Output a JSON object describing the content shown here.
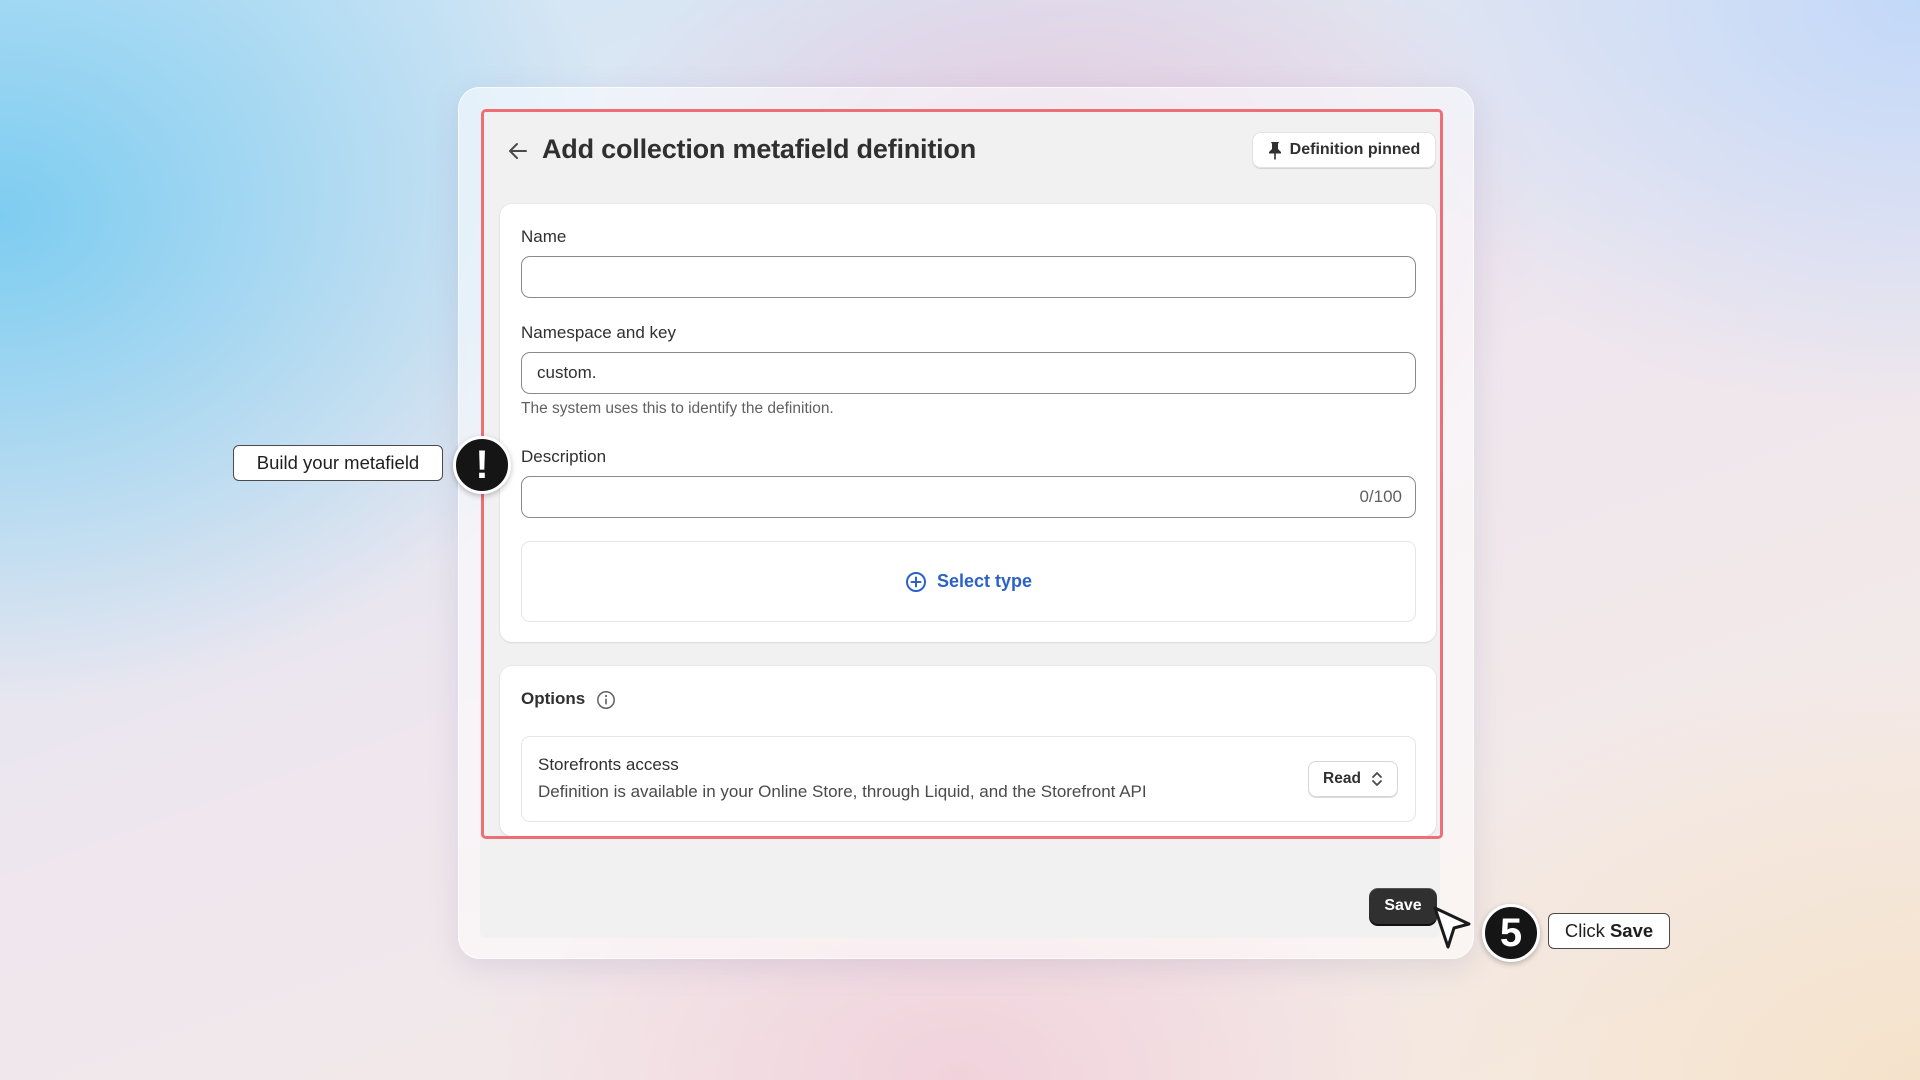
{
  "header": {
    "title": "Add collection metafield definition",
    "pin_label": "Definition pinned"
  },
  "form": {
    "name_label": "Name",
    "name_value": "",
    "namespace_label": "Namespace and key",
    "namespace_value": "custom.",
    "namespace_help": "The system uses this to identify the definition.",
    "description_label": "Description",
    "description_value": "",
    "description_counter": "0/100",
    "select_type_label": "Select type"
  },
  "options": {
    "title": "Options",
    "storefront_title": "Storefronts access",
    "storefront_desc": "Definition is available in your Online Store, through Liquid, and the Storefront API",
    "access_value": "Read"
  },
  "footer": {
    "save_label": "Save"
  },
  "annotations": {
    "left_callout": "Build your metafield",
    "alert_symbol": "!",
    "step_number": "5",
    "right_callout_prefix": "Click",
    "right_callout_bold": "Save"
  },
  "colors": {
    "highlight": "#ee6e78",
    "link": "#2c62c7",
    "primary_button": "#303030"
  },
  "icons": [
    "back-arrow-icon",
    "pin-icon",
    "plus-circle-icon",
    "info-icon",
    "chevron-up-down-icon",
    "cursor-pointer-icon"
  ]
}
